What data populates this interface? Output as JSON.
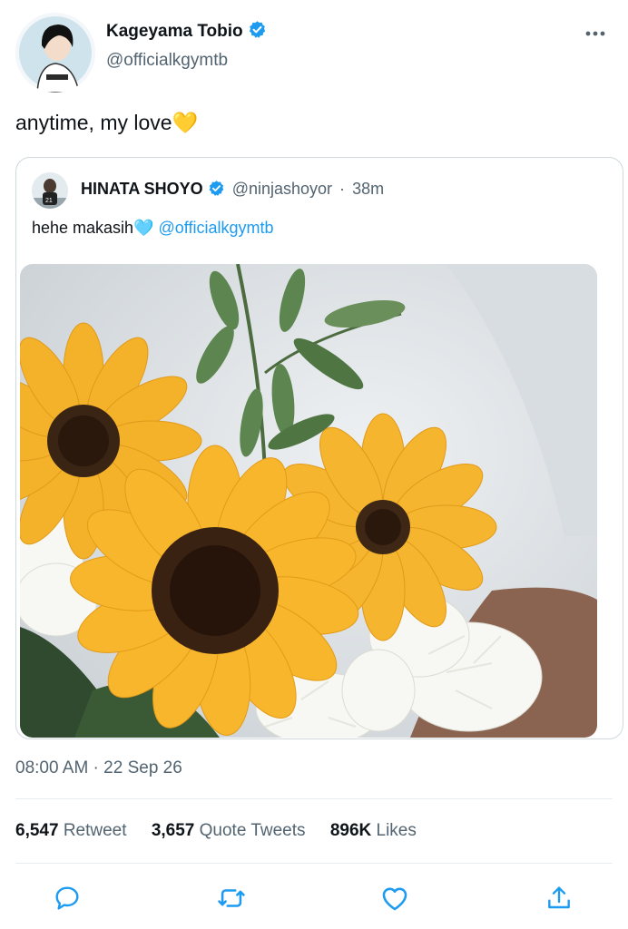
{
  "author": {
    "name": "Kageyama Tobio",
    "handle": "@officialkgymtb",
    "verified": true
  },
  "tweet": {
    "text": "anytime, my love💛"
  },
  "quoted": {
    "name": "HINATA SHOYO",
    "handle": "@ninjashoyor",
    "separator": "·",
    "time": "38m",
    "text": "hehe makasih🩵",
    "mention": "@officialkgymtb"
  },
  "timestamp": "08:00 AM · 22 Sep 26",
  "stats": {
    "retweets_count": "6,547",
    "retweets_label": "Retweet",
    "quotes_count": "3,657",
    "quotes_label": "Quote Tweets",
    "likes_count": "896K",
    "likes_label": "Likes"
  },
  "colors": {
    "link": "#1d9bf0",
    "verified": "#1d9bf0",
    "icon": "#1d9bf0",
    "secondary_text": "#536471"
  },
  "icons": {
    "more": "more-icon",
    "reply": "reply-icon",
    "retweet": "retweet-icon",
    "like": "heart-icon",
    "share": "share-icon"
  }
}
